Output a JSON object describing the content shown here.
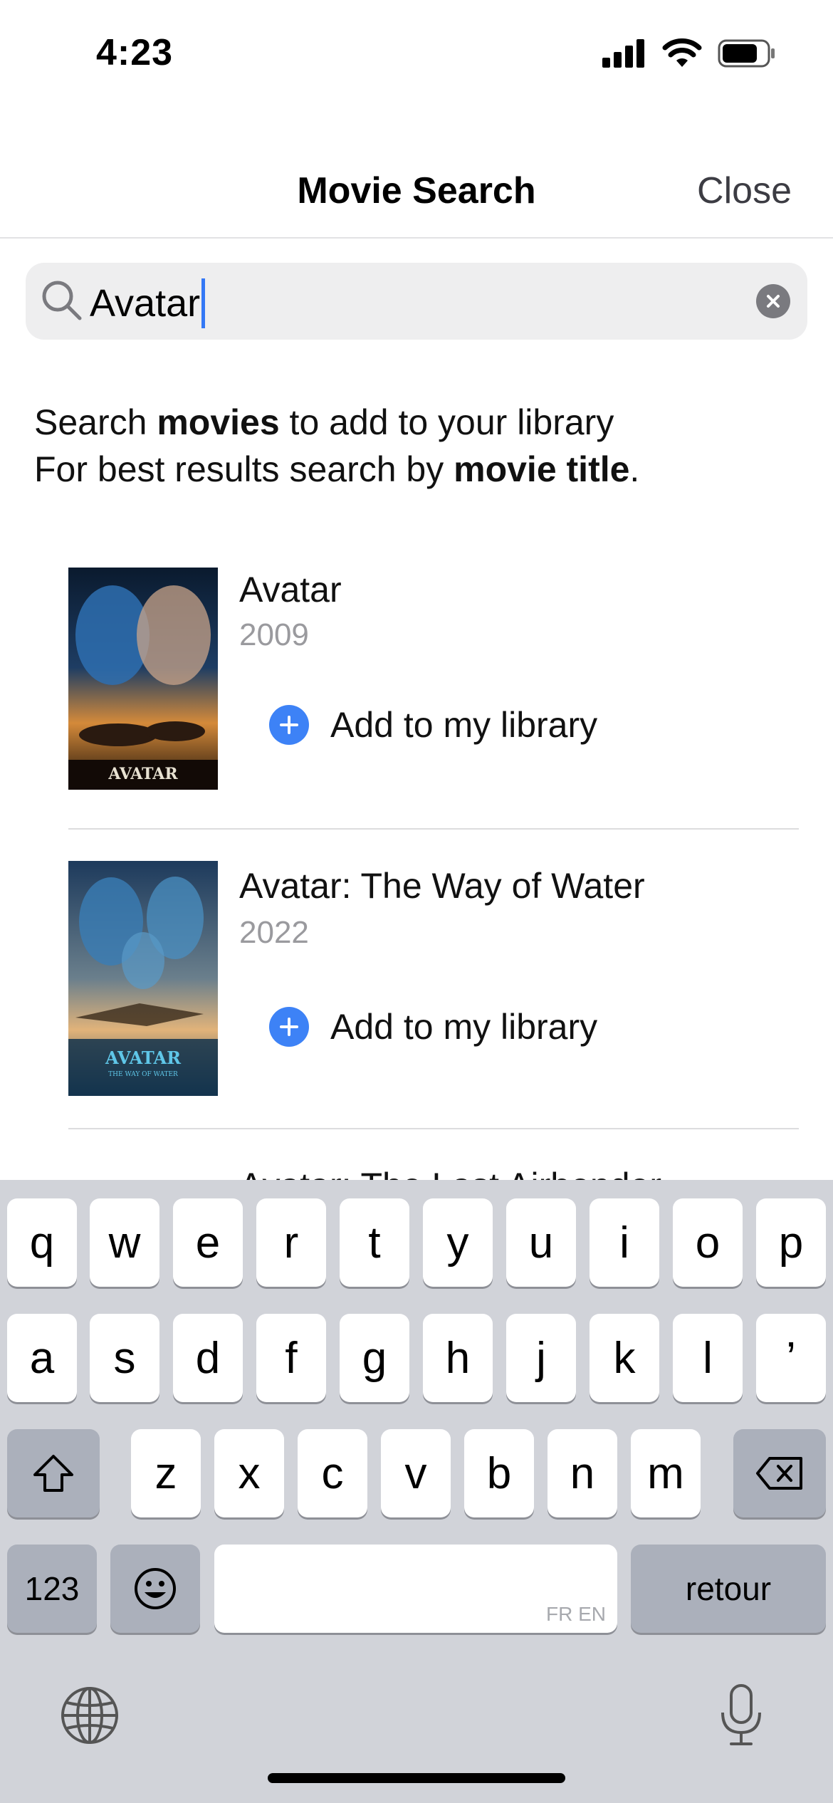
{
  "status_bar": {
    "time": "4:23"
  },
  "nav": {
    "title": "Movie Search",
    "close_label": "Close"
  },
  "search": {
    "value": "Avatar"
  },
  "instructions": {
    "line1_pre": "Search ",
    "line1_bold": "movies",
    "line1_post": " to add to your library",
    "line2_pre": "For best results search by ",
    "line2_bold": "movie title",
    "line2_post": "."
  },
  "results": [
    {
      "title": "Avatar",
      "year": "2009",
      "add_label": "Add to my library",
      "poster_text": "AVATAR"
    },
    {
      "title": "Avatar: The Way of Water",
      "year": "2022",
      "add_label": "Add to my library",
      "poster_text": "AVATAR",
      "poster_subtext": "THE WAY OF WATER"
    },
    {
      "title": "Avatar: The Last Airbender"
    }
  ],
  "keyboard": {
    "row1": [
      "q",
      "w",
      "e",
      "r",
      "t",
      "y",
      "u",
      "i",
      "o",
      "p"
    ],
    "row2": [
      "a",
      "s",
      "d",
      "f",
      "g",
      "h",
      "j",
      "k",
      "l",
      "’"
    ],
    "row3": [
      "z",
      "x",
      "c",
      "v",
      "b",
      "n",
      "m"
    ],
    "numbers_label": "123",
    "space_languages": "FR EN",
    "return_label": "retour"
  },
  "colors": {
    "accent": "#3478f6",
    "add_button": "#3d82f6",
    "keyboard_bg": "#d1d3d9"
  }
}
